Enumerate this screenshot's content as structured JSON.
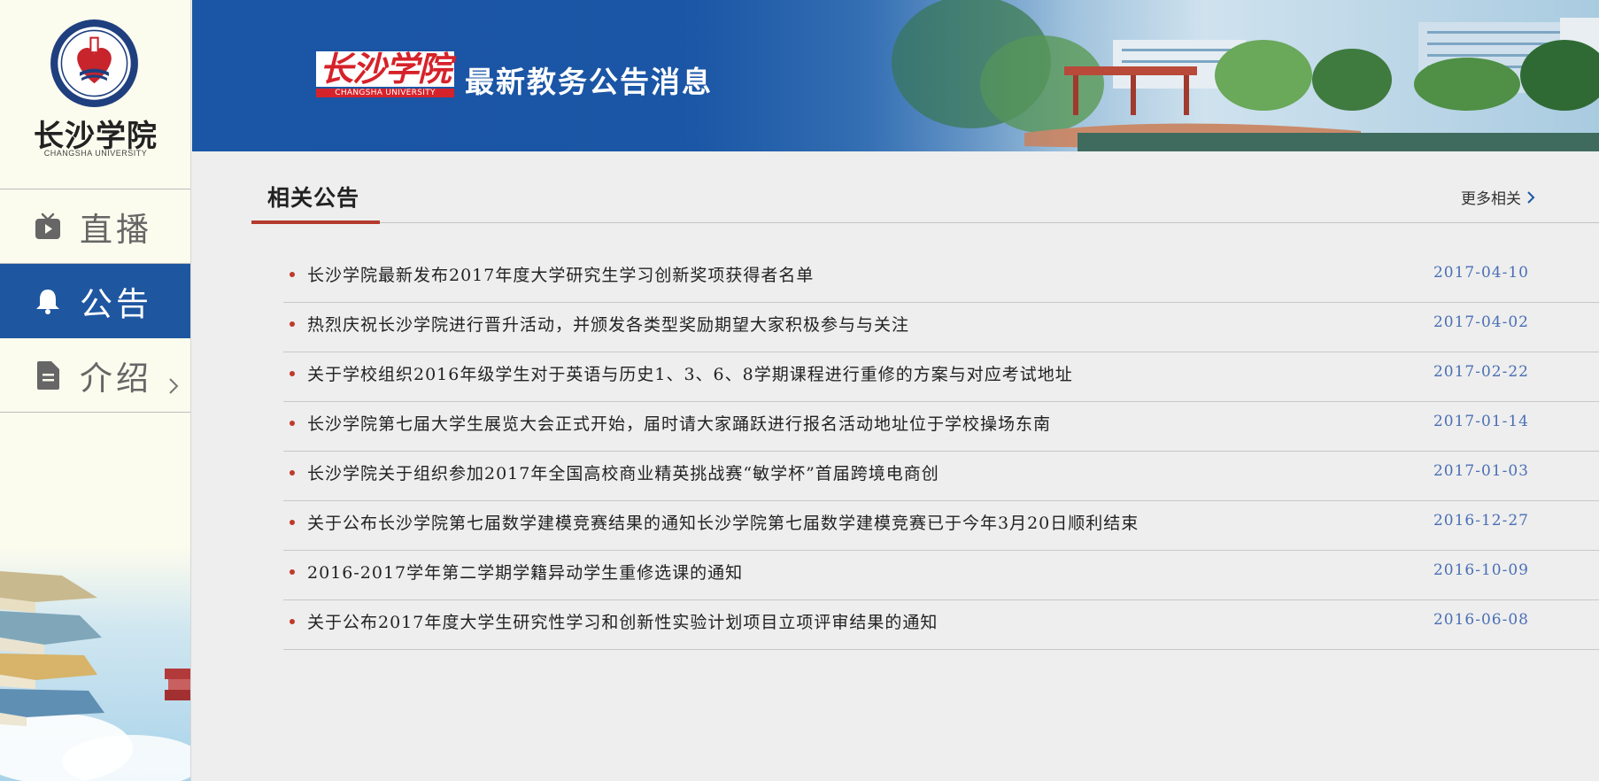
{
  "sidebar": {
    "logo_cn": "长沙学院",
    "logo_en": "CHANGSHA UNIVERSITY",
    "emblem_text": "CHANGSHA UNIVERSITY",
    "items": [
      {
        "label": "直播",
        "icon": "tv-play-icon",
        "active": false
      },
      {
        "label": "公告",
        "icon": "bell-icon",
        "active": true
      },
      {
        "label": "介绍",
        "icon": "document-icon",
        "active": false
      }
    ]
  },
  "banner": {
    "logo_cn": "长沙学院",
    "logo_en": "CHANGSHA UNIVERSITY",
    "title": "最新教务公告消息"
  },
  "section": {
    "title": "相关公告",
    "more_label": "更多相关"
  },
  "notices": [
    {
      "title": "长沙学院最新发布2017年度大学研究生学习创新奖项获得者名单",
      "date": "2017-04-10"
    },
    {
      "title": "热烈庆祝长沙学院进行晋升活动，并颁发各类型奖励期望大家积极参与与关注",
      "date": "2017-04-02"
    },
    {
      "title": "关于学校组织2016年级学生对于英语与历史1、3、6、8学期课程进行重修的方案与对应考试地址",
      "date": "2017-02-22"
    },
    {
      "title": "长沙学院第七届大学生展览大会正式开始，届时请大家踊跃进行报名活动地址位于学校操场东南",
      "date": "2017-01-14"
    },
    {
      "title": "长沙学院关于组织参加2017年全国高校商业精英挑战赛“敏学杯”首届跨境电商创",
      "date": "2017-01-03"
    },
    {
      "title": "关于公布长沙学院第七届数学建模竞赛结果的通知长沙学院第七届数学建模竞赛已于今年3月20日顺利结束",
      "date": "2016-12-27"
    },
    {
      "title": "2016-2017学年第二学期学籍异动学生重修选课的通知",
      "date": "2016-10-09"
    },
    {
      "title": "关于公布2017年度大学生研究性学习和创新性实验计划项目立项评审结果的通知",
      "date": "2016-06-08"
    }
  ],
  "colors": {
    "accent_blue": "#1e56a0",
    "accent_red": "#b53a2e",
    "date_blue": "#4a6fb5",
    "sidebar_bg": "#fbfbee"
  }
}
